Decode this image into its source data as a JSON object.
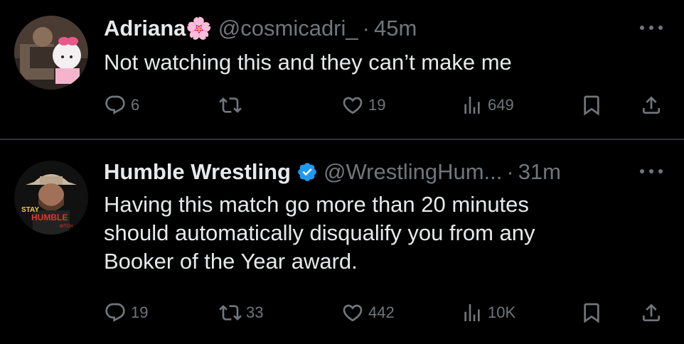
{
  "tweets": [
    {
      "name": "Adriana",
      "name_emoji": "🌸",
      "handle": "@cosmicadri_",
      "separator": "·",
      "time": "45m",
      "verified": false,
      "lines": [
        "Not watching this and they can’t make me"
      ],
      "actions": {
        "replies": "6",
        "retweets": "",
        "likes": "19",
        "views": "649"
      }
    },
    {
      "name": "Humble Wrestling",
      "handle": "@WrestlingHum...",
      "separator": "·",
      "time": "31m",
      "verified": true,
      "avatar_text": [
        "STAY",
        "HUMBLE",
        "BITCH"
      ],
      "lines": [
        "Having this match go more than 20 minutes",
        "should automatically disqualify you from any",
        "Booker of the Year award."
      ],
      "actions": {
        "replies": "19",
        "retweets": "33",
        "likes": "442",
        "views": "10K"
      }
    }
  ],
  "icons": [
    "reply-icon",
    "retweet-icon",
    "like-icon",
    "views-icon",
    "bookmark-icon",
    "share-icon",
    "more-icon",
    "verified-badge-icon",
    "flower-emoji"
  ],
  "colors": {
    "background": "#000000",
    "text": "#e7e9ea",
    "muted": "#71767b",
    "verified": "#1d9bf0",
    "divider": "#2f3336"
  }
}
